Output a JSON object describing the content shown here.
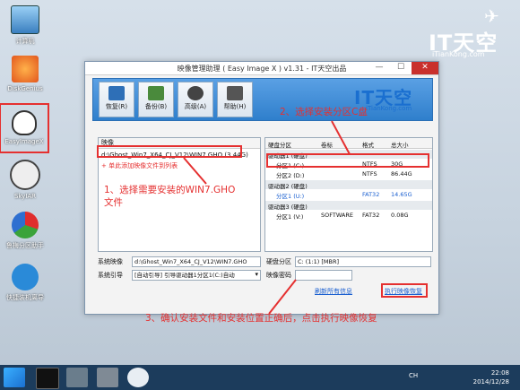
{
  "desktop": {
    "icons": [
      {
        "label": "计算机",
        "icon": "computer-icon"
      },
      {
        "label": "DiskGenius",
        "icon": "diskgenius-icon"
      },
      {
        "label": "EasyImageX",
        "icon": "easyimagex-icon"
      },
      {
        "label": "SkyIAR",
        "icon": "skyiar-icon"
      },
      {
        "label": "鲁梅分区助手",
        "icon": "partition-assistant-icon"
      },
      {
        "label": "快捷装机离导",
        "icon": "quick-install-icon"
      }
    ],
    "watermark": {
      "brand": "IT天空",
      "url": "iTianKong.com"
    }
  },
  "window": {
    "title": "映像管理助理 ( Easy Image X ) v1.31 - IT天空出品",
    "controls": {
      "minimize": "—",
      "maximize": "☐",
      "close": "✕"
    },
    "toolbar": [
      {
        "label": "恢复(R)",
        "icon": "restore-icon"
      },
      {
        "label": "备份(B)",
        "icon": "backup-icon"
      },
      {
        "label": "高级(A)",
        "icon": "advanced-icon"
      },
      {
        "label": "帮助(H)",
        "icon": "help-icon"
      }
    ],
    "logo": {
      "brand": "IT天空",
      "url": "iTianKong.com"
    },
    "image_list": {
      "header": "映像",
      "item": "d:\\Ghost_Win7_X64_CJ_V12\\WIN7.GHO (3.44G)",
      "add_link": "+ 单此添加映像文件到列表"
    },
    "partition_table": {
      "columns": [
        "硬盘分区",
        "卷标",
        "格式",
        "总大小"
      ],
      "drives": [
        {
          "name": "驱动器1 (硬盘)",
          "partitions": [
            {
              "part": "分区1 (C:)",
              "label": "",
              "fs": "NTFS",
              "size": "30G",
              "selected": true
            },
            {
              "part": "分区2 (D:)",
              "label": "",
              "fs": "NTFS",
              "size": "86.44G"
            }
          ]
        },
        {
          "name": "驱动器2 (硬盘)",
          "partitions": [
            {
              "part": "分区1 (U:)",
              "label": "",
              "fs": "FAT32",
              "size": "14.65G"
            }
          ]
        },
        {
          "name": "驱动器3 (硬盘)",
          "partitions": [
            {
              "part": "分区1 (V:)",
              "label": "SOFTWARE",
              "fs": "FAT32",
              "size": "0.08G"
            }
          ]
        }
      ]
    },
    "form": {
      "image_file_label": "系统映像",
      "image_file_value": "d:\\Ghost_Win7_X64_CJ_V12\\WIN7.GHO",
      "boot_label": "系统引导",
      "boot_value": "[自动引导] 引导驱动器1分区1(C:)自动",
      "target_label": "硬盘分区",
      "target_value": "C: (1:1) [MBR]",
      "password_label": "映像密码",
      "password_value": "",
      "refresh_link": "刷新所有信息",
      "execute_button": "执行映像恢复"
    }
  },
  "annotations": {
    "step1": "1、选择需要安装的WIN7.GHO文件",
    "step2": "2、选择安装分区C盘",
    "step3": "3、确认安装文件和安装位置正确后，点击执行映像恢复"
  },
  "taskbar": {
    "items": [
      "start-icon",
      "cmd-icon",
      "explorer-icon",
      "tools-icon",
      "easyimagex-taskbar-icon"
    ],
    "tray": "CH",
    "time": "22:08",
    "date": "2014/12/28"
  },
  "colors": {
    "accent": "#1a6fd0",
    "annotation": "#e53030",
    "taskbar": "#1c3c5c"
  }
}
